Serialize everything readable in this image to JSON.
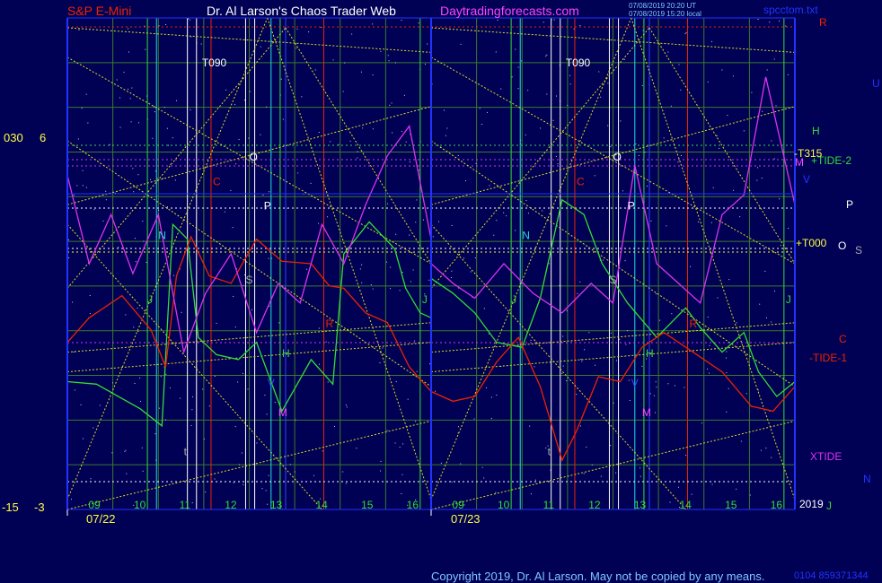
{
  "header": {
    "left_title": "S&P E-Mini",
    "center_title": "Dr. Al Larson's Chaos Trader Web",
    "site": "Daytradingforecasts.com",
    "timestamp_1": "07/08/2019 20:20 UT",
    "timestamp_2": "07/08/2019 15:20 local",
    "file_name": "spcctom.txt"
  },
  "right_labels": {
    "R": "R",
    "U": "U",
    "H": "H",
    "T315": "-T315",
    "M": "M",
    "TIDE2": "+TIDE-2",
    "V": "V",
    "P": "P",
    "T000": "+T000",
    "O": "O",
    "S": "S",
    "C": "C",
    "TIDE1": "-TIDE-1",
    "XTIDE": "XTIDE",
    "N": "N",
    "year": "2019",
    "J": "J"
  },
  "left_axis": {
    "l030": "030",
    "l6": "6",
    "l15": "-15",
    "l3": "-3"
  },
  "panels": [
    {
      "date": "07/22",
      "hours": [
        "09",
        "10",
        "11",
        "12",
        "13",
        "14",
        "15",
        "16"
      ],
      "T090": "T090",
      "letters": {
        "O": "O",
        "C": "C",
        "P": "P",
        "N": "N",
        "S": "S",
        "J": "J",
        "H": "H",
        "V": "V",
        "M": "M",
        "R": "R",
        "t": "t",
        "J2": "J"
      }
    },
    {
      "date": "07/23",
      "hours": [
        "09",
        "10",
        "11",
        "12",
        "13",
        "14",
        "15",
        "16"
      ],
      "T090": "T090",
      "letters": {
        "O": "O",
        "C": "C",
        "P": "P",
        "N": "N",
        "S": "S",
        "J": "J",
        "H": "H",
        "V": "V",
        "M": "M",
        "R": "R",
        "t": "t",
        "J2": "J"
      }
    }
  ],
  "copyright": "Copyright 2019, Dr. Al Larson. May not be copied by any means.",
  "serial": "0104 859371344",
  "colors": {
    "background": "#000055",
    "grid": "#3a7a2a",
    "frame": "#2233ff",
    "green_flow": "#33dd33",
    "red_flow": "#ee2200",
    "magenta_tide": "#dd33ee",
    "yellow_lines": "#dddd22"
  },
  "chart_data": {
    "type": "line",
    "title": "S&P E-Mini",
    "x_sessions": [
      "07/22",
      "07/23"
    ],
    "x_hours": [
      "09",
      "10",
      "11",
      "12",
      "13",
      "14",
      "15",
      "16"
    ],
    "series": [
      {
        "name": "+TIDE-2",
        "color": "#33dd33",
        "session_07_22": [
          [
            0,
            0.26
          ],
          [
            0.08,
            0.255
          ],
          [
            0.2,
            0.205
          ],
          [
            0.26,
            0.17
          ],
          [
            0.29,
            0.58
          ],
          [
            0.33,
            0.55
          ],
          [
            0.36,
            0.35
          ],
          [
            0.41,
            0.315
          ],
          [
            0.47,
            0.305
          ],
          [
            0.52,
            0.34
          ],
          [
            0.59,
            0.2
          ],
          [
            0.67,
            0.305
          ],
          [
            0.73,
            0.255
          ],
          [
            0.76,
            0.52
          ],
          [
            0.83,
            0.585
          ],
          [
            0.9,
            0.53
          ],
          [
            0.93,
            0.45
          ],
          [
            0.97,
            0.4
          ],
          [
            1,
            0.39
          ]
        ],
        "session_07_23": [
          [
            0,
            0.47
          ],
          [
            0.06,
            0.44
          ],
          [
            0.12,
            0.4
          ],
          [
            0.18,
            0.34
          ],
          [
            0.25,
            0.33
          ],
          [
            0.3,
            0.43
          ],
          [
            0.36,
            0.63
          ],
          [
            0.42,
            0.6
          ],
          [
            0.47,
            0.5
          ],
          [
            0.54,
            0.42
          ],
          [
            0.62,
            0.35
          ],
          [
            0.7,
            0.41
          ],
          [
            0.74,
            0.37
          ],
          [
            0.8,
            0.32
          ],
          [
            0.86,
            0.36
          ],
          [
            0.9,
            0.28
          ],
          [
            0.95,
            0.23
          ],
          [
            1,
            0.26
          ]
        ]
      },
      {
        "name": "-TIDE-1",
        "color": "#ee2200",
        "session_07_22": [
          [
            0,
            0.34
          ],
          [
            0.06,
            0.39
          ],
          [
            0.15,
            0.435
          ],
          [
            0.23,
            0.365
          ],
          [
            0.27,
            0.29
          ],
          [
            0.3,
            0.475
          ],
          [
            0.34,
            0.555
          ],
          [
            0.39,
            0.475
          ],
          [
            0.45,
            0.46
          ],
          [
            0.52,
            0.55
          ],
          [
            0.59,
            0.505
          ],
          [
            0.67,
            0.5
          ],
          [
            0.72,
            0.455
          ],
          [
            0.76,
            0.45
          ],
          [
            0.82,
            0.4
          ],
          [
            0.88,
            0.38
          ],
          [
            0.94,
            0.29
          ],
          [
            1,
            0.24
          ]
        ],
        "session_07_23": [
          [
            0,
            0.24
          ],
          [
            0.06,
            0.22
          ],
          [
            0.12,
            0.23
          ],
          [
            0.18,
            0.3
          ],
          [
            0.24,
            0.35
          ],
          [
            0.3,
            0.25
          ],
          [
            0.36,
            0.1
          ],
          [
            0.4,
            0.16
          ],
          [
            0.46,
            0.27
          ],
          [
            0.52,
            0.26
          ],
          [
            0.58,
            0.33
          ],
          [
            0.64,
            0.36
          ],
          [
            0.72,
            0.32
          ],
          [
            0.8,
            0.28
          ],
          [
            0.88,
            0.21
          ],
          [
            0.94,
            0.2
          ],
          [
            1,
            0.25
          ]
        ]
      },
      {
        "name": "XTIDE",
        "color": "#dd33ee",
        "session_07_22": [
          [
            0,
            0.68
          ],
          [
            0.06,
            0.5
          ],
          [
            0.12,
            0.6
          ],
          [
            0.18,
            0.48
          ],
          [
            0.25,
            0.6
          ],
          [
            0.32,
            0.32
          ],
          [
            0.38,
            0.44
          ],
          [
            0.45,
            0.52
          ],
          [
            0.52,
            0.36
          ],
          [
            0.58,
            0.46
          ],
          [
            0.64,
            0.42
          ],
          [
            0.7,
            0.58
          ],
          [
            0.76,
            0.5
          ],
          [
            0.82,
            0.62
          ],
          [
            0.88,
            0.72
          ],
          [
            0.94,
            0.78
          ],
          [
            1,
            0.55
          ]
        ],
        "session_07_23": [
          [
            0,
            0.5
          ],
          [
            0.06,
            0.46
          ],
          [
            0.12,
            0.43
          ],
          [
            0.2,
            0.5
          ],
          [
            0.28,
            0.44
          ],
          [
            0.36,
            0.4
          ],
          [
            0.44,
            0.46
          ],
          [
            0.5,
            0.42
          ],
          [
            0.56,
            0.7
          ],
          [
            0.62,
            0.5
          ],
          [
            0.68,
            0.46
          ],
          [
            0.74,
            0.42
          ],
          [
            0.8,
            0.6
          ],
          [
            0.86,
            0.64
          ],
          [
            0.92,
            0.88
          ],
          [
            1,
            0.62
          ]
        ]
      }
    ],
    "grid": true
  }
}
